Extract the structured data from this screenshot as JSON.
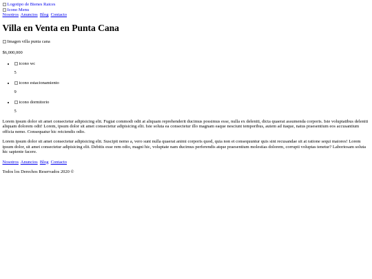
{
  "header": {
    "logo_alt": "Logotipo de Bienes Raices",
    "menu_icon_alt": "Icono Menu",
    "nav": [
      "Nosotros",
      "Anuncios",
      "Blog",
      "Contacto"
    ]
  },
  "listing": {
    "title": "Villa en Venta en Punta Cana",
    "image_alt": "Imagen villa punta cana",
    "price": "$6,000,000",
    "features": [
      {
        "icon_alt": "icono wc",
        "icon": "wc-icon",
        "count": "5"
      },
      {
        "icon_alt": "icono estacionamiento",
        "icon": "parking-icon",
        "count": "9"
      },
      {
        "icon_alt": "icono dormitorio",
        "icon": "bedroom-icon",
        "count": "5"
      }
    ],
    "paragraphs": [
      "Lorem ipsum dolor sit amet consectetur adipisicing elit. Fugiat commodi odit at aliquam reprehenderit ducimus possimus esse, nulla ex deleniti, dicta quaerat assumenda corporis. Iste voluptatibus deleniti aliquam dolorem odit! Lorem, ipsum dolor sit amet consectetur adipisicing elit. Iste soluta ea consectetur illo magnam eaque nesciunt temporibus, autem ad itaque, natus praesentium eos accusantium officia nemo. Consequatur hic reiciendis odio.",
      "Lorem ipsum dolor sit amet consectetur adipisicing elit. Suscipit nemo a, vero sunt nulla quaerat animi corporis quod, quia non et consequuntur quis sint recusandae sit at ratione sequi maiores! Lorem ipsum dolor, sit amet consectetur adipisicing elit. Debitis esse rem odio, magni hic, voluptate nam ducimus perferendis atque praesentium molestias dolorem, corrupti voluptas tenetur? Laboriosam soluta hic sapiente facere."
    ]
  },
  "footer": {
    "nav": [
      "Nosotros",
      "Anuncios",
      "Blog",
      "Contacto"
    ],
    "copyright": "Todos los Derechos Reservados 2020 ©"
  }
}
